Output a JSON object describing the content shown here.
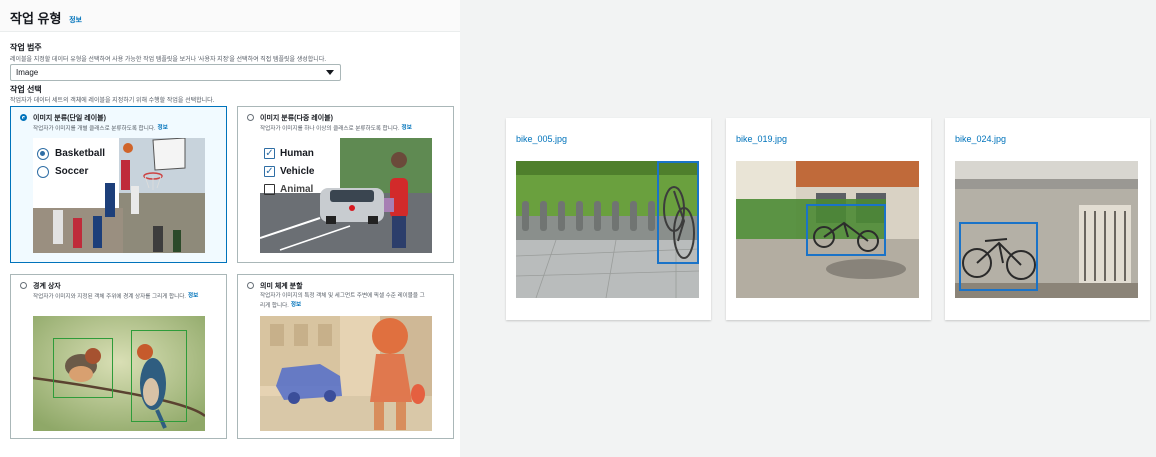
{
  "panel": {
    "title": "작업 유형",
    "info": "정보"
  },
  "category": {
    "label": "작업 범주",
    "description": "레이블을 지정할 데이터 유형을 선택하여 사용 가능한 작업 템플릿을 보거나 '사용자 지정'을 선택하여 직접 템플릿을 생성합니다.",
    "selected": "Image"
  },
  "task_select": {
    "label": "작업 선택",
    "description": "작업자가 데이터 세트의 객체에 레이블을 지정하기 위해 수행할 작업을 선택합니다."
  },
  "cards": [
    {
      "title": "이미지 분류(단일 레이블)",
      "description": "작업자가 이미지를 개별 클래스로 분류하도록 합니다.",
      "info": "정보",
      "selected": true,
      "options": [
        "Basketball",
        "Soccer"
      ]
    },
    {
      "title": "이미지 분류(다중 레이블)",
      "description": "작업자가 이미지를 하나 이상의 클래스로 분류하도록 합니다.",
      "info": "정보",
      "selected": false,
      "options": [
        "Human",
        "Vehicle",
        "Animal"
      ]
    },
    {
      "title": "경계 상자",
      "description": "작업자가 이미지와 지정된 객체 주위에 경계 상자를 그리게 합니다.",
      "info": "정보",
      "selected": false
    },
    {
      "title": "의미 체계 분할",
      "description_line1": "작업자가 이미지의 특정 객체 및 세그먼트 주변에 픽셀 수준 레이블을 그",
      "description_line2": "리게 합니다.",
      "info": "정보",
      "selected": false
    }
  ],
  "tiles": [
    {
      "filename": "bike_005.jpg"
    },
    {
      "filename": "bike_019.jpg"
    },
    {
      "filename": "bike_024.jpg"
    }
  ],
  "colors": {
    "accent": "#0073bb",
    "bbox": "#1a73c8",
    "bbox_green": "#2e9c3a"
  }
}
